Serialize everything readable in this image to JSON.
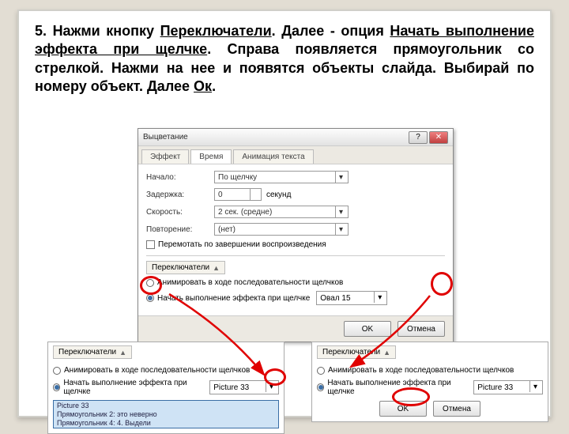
{
  "instruction": {
    "number": "5.",
    "text_parts": {
      "p1": "Нажми кнопку ",
      "u1": "Переключатели",
      "p2": ". Далее - опция ",
      "u2": "Начать выполнение эффекта при щелчке",
      "p3": ". Справа появляется прямоугольник со стрелкой. Нажми на нее и появятся объекты слайда. Выбирай по номеру объект. Далее ",
      "u3": "Ок",
      "p4": "."
    }
  },
  "dialog": {
    "title": "Выцветание",
    "win_help": "?",
    "win_close": "✕",
    "tabs": {
      "t1": "Эффект",
      "t2": "Время",
      "t3": "Анимация текста"
    },
    "fields": {
      "start_label": "Начало:",
      "start_value": "По щелчку",
      "delay_label": "Задержка:",
      "delay_value": "0",
      "delay_unit": "секунд",
      "speed_label": "Скорость:",
      "speed_value": "2 сек. (средне)",
      "repeat_label": "Повторение:",
      "repeat_value": "(нет)",
      "rewind_label": "Перемотать по завершении воспроизведения"
    },
    "triggers": {
      "section_label": "Переключатели",
      "collapse": "▲",
      "opt_anim": "Анимировать в ходе последовательности щелчков",
      "opt_start": "Начать выполнение эффекта при щелчке",
      "target": "Овал 15"
    },
    "buttons": {
      "ok": "OK",
      "cancel": "Отмена"
    }
  },
  "snippet_left": {
    "section_label": "Переключатели",
    "collapse": "▲",
    "opt_anim": "Анимировать в ходе последовательности щелчков",
    "opt_start": "Начать выполнение эффекта при щелчке",
    "target": "Picture 33",
    "list1": "Picture 33",
    "list2": "Прямоугольник 2: это неверно",
    "list3": "Прямоугольник 4: 4. Выдели"
  },
  "snippet_right": {
    "section_label": "Переключатели",
    "collapse": "▲",
    "opt_anim": "Анимировать в ходе последовательности щелчков",
    "opt_start": "Начать выполнение эффекта при щелчке",
    "target": "Picture 33",
    "ok": "OK",
    "cancel": "Отмена"
  }
}
